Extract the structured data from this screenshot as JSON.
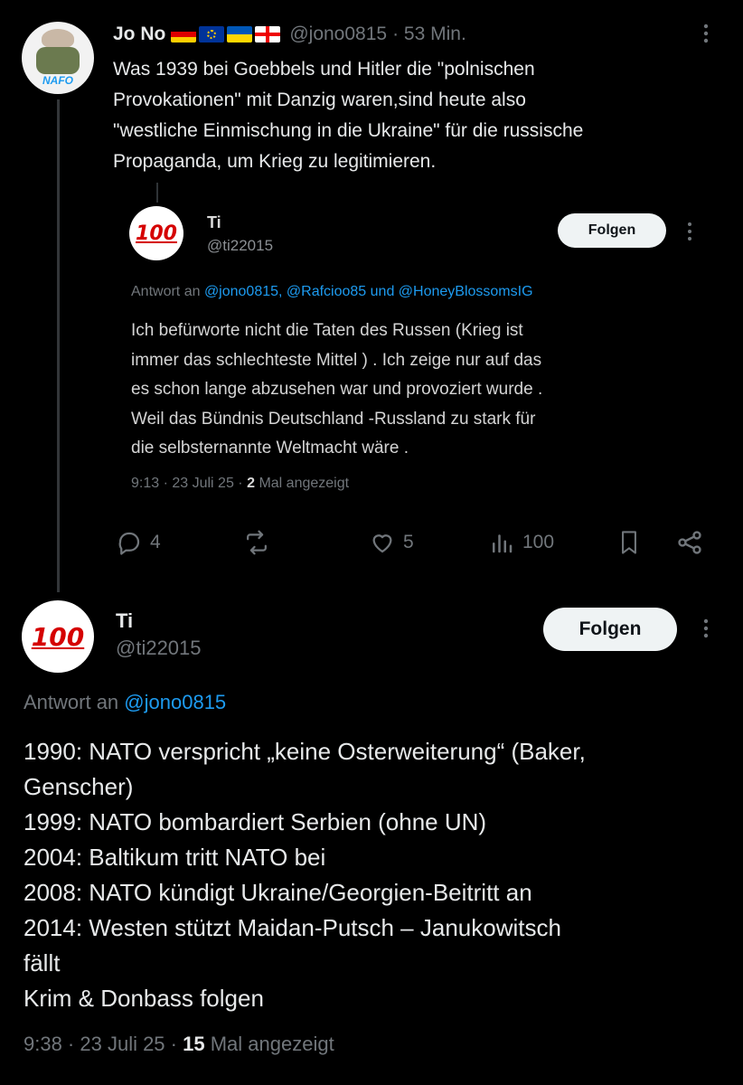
{
  "tweet1": {
    "author_name": "Jo No",
    "avatar_text": "NAFO",
    "handle": "@jono0815",
    "time": "· 53 Min.",
    "text_lines": [
      "Was 1939 bei Goebbels und Hitler die \"polnischen",
      "Provokationen\" mit Danzig waren,sind heute also",
      "\"westliche Einmischung in die Ukraine\" für die russische",
      "Propaganda, um Krieg zu legitimieren."
    ],
    "quote": {
      "author_name": "Ti",
      "avatar_text": "100",
      "handle": "@ti22015",
      "follow_label": "Folgen",
      "reply_prefix": "Antwort an",
      "reply_to": "@jono0815, @Rafcioo85 und @HoneyBlossomsIG",
      "text_lines": [
        "Ich befürworte nicht die Taten des Russen (Krieg ist",
        "immer das schlechteste Mittel ) . Ich zeige nur auf das",
        "es schon lange abzusehen war und provoziert wurde .",
        "Weil das Bündnis Deutschland -Russland zu stark für",
        "die selbsternannte Weltmacht wäre ."
      ],
      "meta_time": "9:13 · 23 Juli 25 ·",
      "meta_views": "2",
      "meta_views_label": "Mal angezeigt"
    },
    "actions": {
      "replies": "4",
      "likes": "5",
      "views": "100"
    }
  },
  "tweet2": {
    "author_name": "Ti",
    "avatar_text": "100",
    "handle": "@ti22015",
    "follow_label": "Folgen",
    "reply_prefix": "Antwort an",
    "reply_to": "@jono0815",
    "text_lines": [
      "1990: NATO verspricht „keine Osterweiterung“ (Baker,",
      "Genscher)",
      "1999: NATO bombardiert Serbien (ohne UN)",
      "2004: Baltikum tritt NATO bei",
      "2008: NATO kündigt Ukraine/Georgien-Beitritt an",
      "2014: Westen stützt Maidan-Putsch – Janukowitsch",
      "fällt",
      "Krim & Donbass folgen"
    ],
    "meta_time": "9:38 · 23 Juli 25 ·",
    "meta_views": "15",
    "meta_views_label": "Mal angezeigt"
  },
  "colors": {
    "accent": "#1d9bf0",
    "muted": "#71767b",
    "text": "#e7e9ea",
    "background": "#000000"
  }
}
